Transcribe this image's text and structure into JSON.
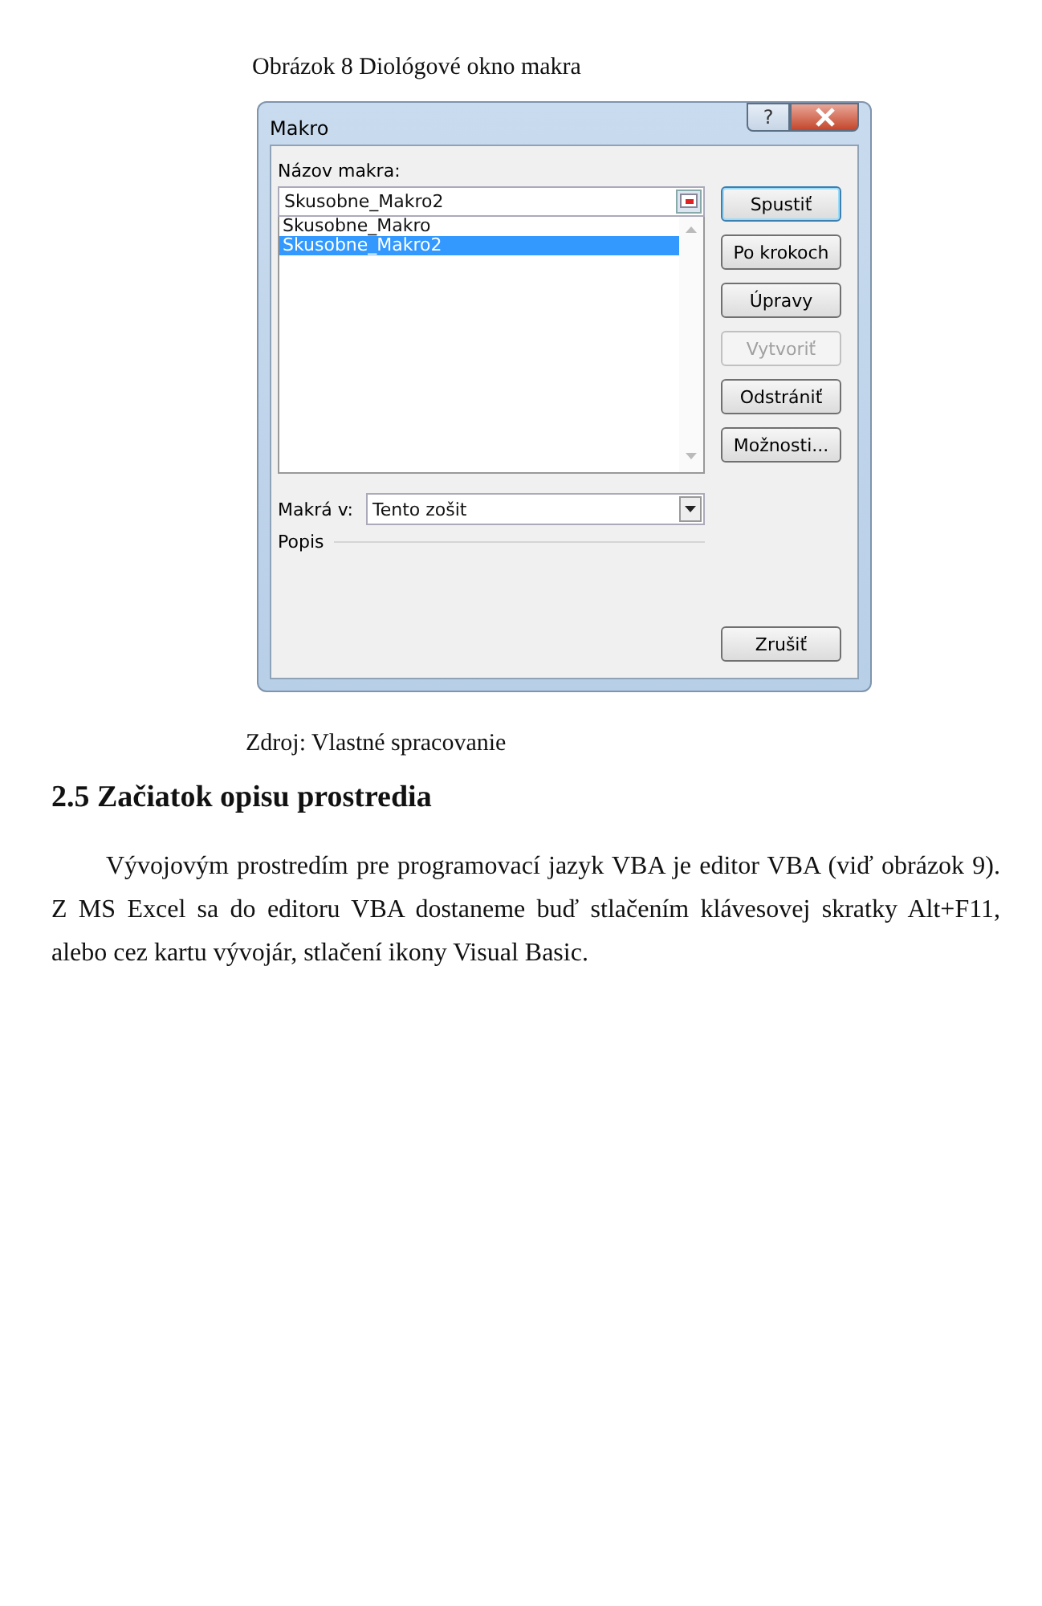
{
  "figure_caption": "Obrázok 8 Diológové okno makra",
  "dialog": {
    "title": "Makro",
    "help_button": "?",
    "name_label": "Názov makra:",
    "name_value": "Skusobne_Makro2",
    "macros": [
      {
        "label": "Skusobne_Makro",
        "selected": false
      },
      {
        "label": "Skusobne_Makro2",
        "selected": true
      }
    ],
    "buttons": [
      {
        "label": "Spustiť",
        "default": true,
        "disabled": false
      },
      {
        "label": "Po krokoch",
        "default": false,
        "disabled": false
      },
      {
        "label": "Úpravy",
        "default": false,
        "disabled": false
      },
      {
        "label": "Vytvoriť",
        "default": false,
        "disabled": true
      },
      {
        "label": "Odstrániť",
        "default": false,
        "disabled": false
      },
      {
        "label": "Možnosti...",
        "default": false,
        "disabled": false
      }
    ],
    "macros_in_label": "Makrá v:",
    "macros_in_value": "Tento zošit",
    "description_label": "Popis",
    "cancel_button": "Zrušiť"
  },
  "source": "Zdroj: Vlastné spracovanie",
  "heading": "2.5 Začiatok opisu prostredia",
  "paragraph": "Vývojovým prostredím pre programovací jazyk VBA je editor VBA (viď obrázok 9). Z MS Excel sa do editoru VBA dostaneme buď stlačením klávesovej skratky Alt+F11, alebo cez kartu vývojár, stlačení ikony Visual Basic."
}
